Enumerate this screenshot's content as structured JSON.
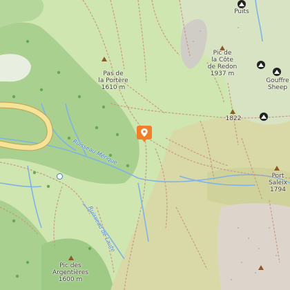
{
  "map": {
    "colors": {
      "meadow": "#cfe6b0",
      "forest": "#a9d08e",
      "forest_dark": "#8fbf75",
      "scrub": "#d8d9a6",
      "rock": "#ddd5cc",
      "water": "#7fb3e6",
      "road": "#f5e39a",
      "path": "#c99a86",
      "marker": "#f07e2a",
      "summit": "#8a5a2b"
    },
    "places": [
      {
        "name": "Pas de la Portère",
        "elevation": "1610 m"
      },
      {
        "name": "Pic de la Côte de Redon",
        "elevation": "1937 m"
      },
      {
        "name": "Puits",
        "elevation": ""
      },
      {
        "name": "Gouffre Sheep",
        "elevation": ""
      },
      {
        "name": "Port de Saleix",
        "elevation": "1794"
      },
      {
        "name": "Pic des Argentières",
        "elevation": "1600 m"
      },
      {
        "name": "",
        "elevation": "1822"
      }
    ],
    "labels": {
      "portere_1": "Pas de",
      "portere_2": "la Portère",
      "portere_elev": "1610 m",
      "redon_1": "Pic de",
      "redon_2": "la Côte",
      "redon_3": "de Redon",
      "redon_elev": "1937 m",
      "puits": "Puits",
      "gouffre_1": "Gouffre",
      "gouffre_2": "Sheep",
      "spot_1822": "1822",
      "port_1": "Port",
      "port_2": "Saleix",
      "port_elev": "1794",
      "argent_1": "Pic des",
      "argent_2": "Argentières",
      "argent_elev": "1600 m"
    },
    "streams": {
      "merique": "Ruisseau Mérique",
      "laute": "Ruisseau de Laute"
    },
    "icons": {
      "location_marker": "map-pin-icon",
      "summit": "summit-triangle-icon",
      "cave": "cave-icon",
      "spring": "spring-icon",
      "tree": "tree-icon"
    }
  }
}
